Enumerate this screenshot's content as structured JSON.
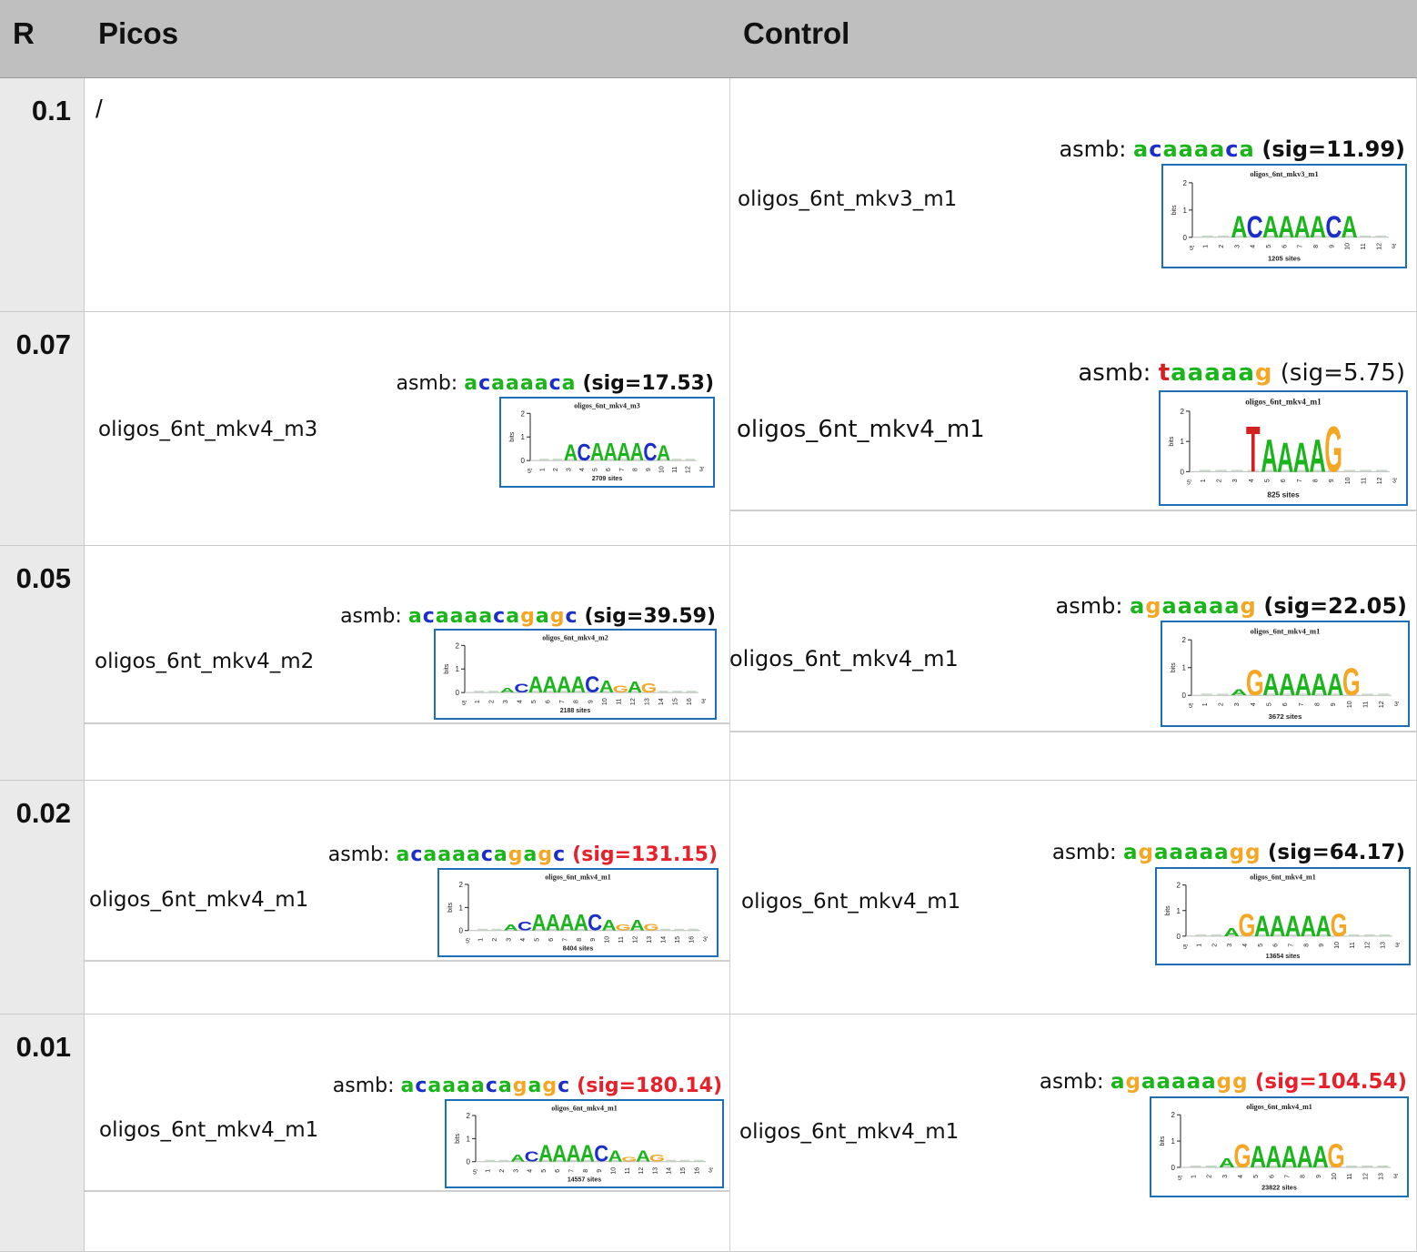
{
  "header": {
    "r": "R",
    "picos": "Picos",
    "control": "Control"
  },
  "axis": {
    "ytick2": "2",
    "ytick1": "1",
    "ytick0": "0",
    "ylabel": "bits",
    "five": "5'",
    "three": "3'"
  },
  "rows": [
    {
      "r": "0.1",
      "picos": {
        "empty": "/"
      },
      "control": {
        "name": "oligos_6nt_mkv3_m1",
        "label": "asmb:",
        "seq": "acaaaaca",
        "sig": "(sig=11.99)",
        "sig_color": "#111111",
        "logo": {
          "title": "oligos_6nt_mkv3_m1",
          "sites": "1205 sites",
          "ticks": [
            "1",
            "2",
            "3",
            "4",
            "5",
            "6",
            "7",
            "8",
            "9",
            "10",
            "11",
            "12"
          ],
          "letters": [
            {
              "pos": 3,
              "ch": "A",
              "h": 0.82,
              "c": "#1ab51a"
            },
            {
              "pos": 4,
              "ch": "C",
              "h": 0.82,
              "c": "#1b2ec9"
            },
            {
              "pos": 5,
              "ch": "A",
              "h": 0.82,
              "c": "#1ab51a"
            },
            {
              "pos": 6,
              "ch": "A",
              "h": 0.82,
              "c": "#1ab51a"
            },
            {
              "pos": 7,
              "ch": "A",
              "h": 0.82,
              "c": "#1ab51a"
            },
            {
              "pos": 8,
              "ch": "A",
              "h": 0.82,
              "c": "#1ab51a"
            },
            {
              "pos": 9,
              "ch": "C",
              "h": 0.82,
              "c": "#1b2ec9"
            },
            {
              "pos": 10,
              "ch": "A",
              "h": 0.82,
              "c": "#1ab51a"
            }
          ]
        }
      }
    },
    {
      "r": "0.07",
      "picos": {
        "name": "oligos_6nt_mkv4_m3",
        "label": "asmb:",
        "seq": "acaaaaca",
        "sig": "(sig=17.53)",
        "sig_color": "#111111",
        "logo": {
          "title": "oligos_6nt_mkv4_m3",
          "sites": "2709 sites",
          "ticks": [
            "1",
            "2",
            "3",
            "4",
            "5",
            "6",
            "7",
            "8",
            "9",
            "10",
            "11",
            "12"
          ],
          "letters": [
            {
              "pos": 3,
              "ch": "A",
              "h": 0.7,
              "c": "#1ab51a"
            },
            {
              "pos": 4,
              "ch": "C",
              "h": 0.72,
              "c": "#1b2ec9"
            },
            {
              "pos": 5,
              "ch": "A",
              "h": 0.76,
              "c": "#1ab51a"
            },
            {
              "pos": 6,
              "ch": "A",
              "h": 0.76,
              "c": "#1ab51a"
            },
            {
              "pos": 7,
              "ch": "A",
              "h": 0.76,
              "c": "#1ab51a"
            },
            {
              "pos": 8,
              "ch": "A",
              "h": 0.76,
              "c": "#1ab51a"
            },
            {
              "pos": 9,
              "ch": "C",
              "h": 0.76,
              "c": "#1b2ec9"
            },
            {
              "pos": 10,
              "ch": "A",
              "h": 0.68,
              "c": "#1ab51a"
            }
          ]
        }
      },
      "control": {
        "name": "oligos_6nt_mkv4_m1",
        "label": "asmb:",
        "seq": "taaaaag",
        "sig": "(sig=5.75)",
        "sig_color": "#111111",
        "logo": {
          "title": "oligos_6nt_mkv4_m1",
          "sites": "825 sites",
          "ticks": [
            "1",
            "2",
            "3",
            "4",
            "5",
            "6",
            "7",
            "8",
            "9",
            "10",
            "11",
            "12"
          ],
          "letters": [
            {
              "pos": 4,
              "ch": "T",
              "h": 1.55,
              "c": "#d42020"
            },
            {
              "pos": 5,
              "ch": "A",
              "h": 1.1,
              "c": "#1ab51a"
            },
            {
              "pos": 6,
              "ch": "A",
              "h": 1.0,
              "c": "#1ab51a"
            },
            {
              "pos": 7,
              "ch": "A",
              "h": 1.0,
              "c": "#1ab51a"
            },
            {
              "pos": 8,
              "ch": "A",
              "h": 1.1,
              "c": "#1ab51a"
            },
            {
              "pos": 9,
              "ch": "G",
              "h": 1.55,
              "c": "#f5a623"
            }
          ]
        }
      }
    },
    {
      "r": "0.05",
      "picos": {
        "name": "oligos_6nt_mkv4_m2",
        "label": "asmb:",
        "seq": "acaaaacagagc",
        "sig": "(sig=39.59)",
        "sig_color": "#111111",
        "logo": {
          "title": "oligos_6nt_mkv4_m2",
          "sites": "2188 sites",
          "ticks": [
            "1",
            "2",
            "3",
            "4",
            "5",
            "6",
            "7",
            "8",
            "9",
            "10",
            "11",
            "12",
            "13",
            "14",
            "15",
            "16"
          ],
          "letters": [
            {
              "pos": 3,
              "ch": "A",
              "h": 0.2,
              "c": "#1ab51a"
            },
            {
              "pos": 4,
              "ch": "C",
              "h": 0.38,
              "c": "#1b2ec9"
            },
            {
              "pos": 5,
              "ch": "A",
              "h": 0.7,
              "c": "#1ab51a"
            },
            {
              "pos": 6,
              "ch": "A",
              "h": 0.7,
              "c": "#1ab51a"
            },
            {
              "pos": 7,
              "ch": "A",
              "h": 0.7,
              "c": "#1ab51a"
            },
            {
              "pos": 8,
              "ch": "A",
              "h": 0.7,
              "c": "#1ab51a"
            },
            {
              "pos": 9,
              "ch": "C",
              "h": 0.7,
              "c": "#1b2ec9"
            },
            {
              "pos": 10,
              "ch": "A",
              "h": 0.52,
              "c": "#1ab51a"
            },
            {
              "pos": 11,
              "ch": "G",
              "h": 0.3,
              "c": "#f5a623"
            },
            {
              "pos": 12,
              "ch": "A",
              "h": 0.5,
              "c": "#1ab51a"
            },
            {
              "pos": 13,
              "ch": "G",
              "h": 0.42,
              "c": "#f5a623"
            }
          ]
        }
      },
      "control": {
        "name": "oligos_6nt_mkv4_m1",
        "label": "asmb:",
        "seq": "agaaaaag",
        "sig": "(sig=22.05)",
        "sig_color": "#111111",
        "logo": {
          "title": "oligos_6nt_mkv4_m1",
          "sites": "3672 sites",
          "ticks": [
            "1",
            "2",
            "3",
            "4",
            "5",
            "6",
            "7",
            "8",
            "9",
            "10",
            "11",
            "12"
          ],
          "letters": [
            {
              "pos": 3,
              "ch": "A",
              "h": 0.22,
              "c": "#1ab51a"
            },
            {
              "pos": 4,
              "ch": "G",
              "h": 0.95,
              "c": "#f5a623"
            },
            {
              "pos": 5,
              "ch": "A",
              "h": 0.8,
              "c": "#1ab51a"
            },
            {
              "pos": 6,
              "ch": "A",
              "h": 0.8,
              "c": "#1ab51a"
            },
            {
              "pos": 7,
              "ch": "A",
              "h": 0.8,
              "c": "#1ab51a"
            },
            {
              "pos": 8,
              "ch": "A",
              "h": 0.8,
              "c": "#1ab51a"
            },
            {
              "pos": 9,
              "ch": "A",
              "h": 0.8,
              "c": "#1ab51a"
            },
            {
              "pos": 10,
              "ch": "G",
              "h": 1.0,
              "c": "#f5a623"
            }
          ]
        }
      }
    },
    {
      "r": "0.02",
      "picos": {
        "name": "oligos_6nt_mkv4_m1",
        "label": "asmb:",
        "seq": "acaaaacagagc",
        "sig": "(sig=131.15)",
        "sig_color": "#e8202a",
        "logo": {
          "title": "oligos_6nt_mkv4_m1",
          "sites": "8404 sites",
          "ticks": [
            "1",
            "2",
            "3",
            "4",
            "5",
            "6",
            "7",
            "8",
            "9",
            "10",
            "11",
            "12",
            "13",
            "14",
            "15",
            "16"
          ],
          "letters": [
            {
              "pos": 3,
              "ch": "A",
              "h": 0.26,
              "c": "#1ab51a"
            },
            {
              "pos": 4,
              "ch": "C",
              "h": 0.4,
              "c": "#1b2ec9"
            },
            {
              "pos": 5,
              "ch": "A",
              "h": 0.72,
              "c": "#1ab51a"
            },
            {
              "pos": 6,
              "ch": "A",
              "h": 0.72,
              "c": "#1ab51a"
            },
            {
              "pos": 7,
              "ch": "A",
              "h": 0.72,
              "c": "#1ab51a"
            },
            {
              "pos": 8,
              "ch": "A",
              "h": 0.72,
              "c": "#1ab51a"
            },
            {
              "pos": 9,
              "ch": "C",
              "h": 0.7,
              "c": "#1b2ec9"
            },
            {
              "pos": 10,
              "ch": "A",
              "h": 0.48,
              "c": "#1ab51a"
            },
            {
              "pos": 11,
              "ch": "G",
              "h": 0.26,
              "c": "#f5a623"
            },
            {
              "pos": 12,
              "ch": "A",
              "h": 0.46,
              "c": "#1ab51a"
            },
            {
              "pos": 13,
              "ch": "G",
              "h": 0.3,
              "c": "#f5a623"
            }
          ]
        }
      },
      "control": {
        "name": "oligos_6nt_mkv4_m1",
        "label": "asmb:",
        "seq": "agaaaaagg",
        "sig": "(sig=64.17)",
        "sig_color": "#111111",
        "logo": {
          "title": "oligos_6nt_mkv4_m1",
          "sites": "13654 sites",
          "ticks": [
            "1",
            "2",
            "3",
            "4",
            "5",
            "6",
            "7",
            "8",
            "9",
            "10",
            "11",
            "12",
            "13"
          ],
          "letters": [
            {
              "pos": 3,
              "ch": "A",
              "h": 0.32,
              "c": "#1ab51a"
            },
            {
              "pos": 4,
              "ch": "G",
              "h": 0.9,
              "c": "#f5a623"
            },
            {
              "pos": 5,
              "ch": "A",
              "h": 0.84,
              "c": "#1ab51a"
            },
            {
              "pos": 6,
              "ch": "A",
              "h": 0.84,
              "c": "#1ab51a"
            },
            {
              "pos": 7,
              "ch": "A",
              "h": 0.84,
              "c": "#1ab51a"
            },
            {
              "pos": 8,
              "ch": "A",
              "h": 0.84,
              "c": "#1ab51a"
            },
            {
              "pos": 9,
              "ch": "A",
              "h": 0.84,
              "c": "#1ab51a"
            },
            {
              "pos": 10,
              "ch": "G",
              "h": 0.9,
              "c": "#f5a623"
            }
          ]
        }
      }
    },
    {
      "r": "0.01",
      "picos": {
        "name": "oligos_6nt_mkv4_m1",
        "label": "asmb:",
        "seq": "acaaaacagagc",
        "sig": "(sig=180.14)",
        "sig_color": "#e8202a",
        "logo": {
          "title": "oligos_6nt_mkv4_m1",
          "sites": "14557 sites",
          "ticks": [
            "1",
            "2",
            "3",
            "4",
            "5",
            "6",
            "7",
            "8",
            "9",
            "10",
            "11",
            "12",
            "13",
            "14",
            "15",
            "16"
          ],
          "letters": [
            {
              "pos": 3,
              "ch": "A",
              "h": 0.3,
              "c": "#1ab51a"
            },
            {
              "pos": 4,
              "ch": "C",
              "h": 0.44,
              "c": "#1b2ec9"
            },
            {
              "pos": 5,
              "ch": "A",
              "h": 0.74,
              "c": "#1ab51a"
            },
            {
              "pos": 6,
              "ch": "A",
              "h": 0.74,
              "c": "#1ab51a"
            },
            {
              "pos": 7,
              "ch": "A",
              "h": 0.74,
              "c": "#1ab51a"
            },
            {
              "pos": 8,
              "ch": "A",
              "h": 0.74,
              "c": "#1ab51a"
            },
            {
              "pos": 9,
              "ch": "C",
              "h": 0.72,
              "c": "#1b2ec9"
            },
            {
              "pos": 10,
              "ch": "A",
              "h": 0.5,
              "c": "#1ab51a"
            },
            {
              "pos": 11,
              "ch": "G",
              "h": 0.22,
              "c": "#f5a623"
            },
            {
              "pos": 12,
              "ch": "A",
              "h": 0.5,
              "c": "#1ab51a"
            },
            {
              "pos": 13,
              "ch": "G",
              "h": 0.3,
              "c": "#f5a623"
            }
          ]
        }
      },
      "control": {
        "name": "oligos_6nt_mkv4_m1",
        "label": "asmb:",
        "seq": "agaaaaagg",
        "sig": "(sig=104.54)",
        "sig_color": "#e8202a",
        "logo": {
          "title": "oligos_6nt_mkv4_m1",
          "sites": "23822 sites",
          "ticks": [
            "1",
            "2",
            "3",
            "4",
            "5",
            "6",
            "7",
            "8",
            "9",
            "10",
            "11",
            "12",
            "13"
          ],
          "letters": [
            {
              "pos": 3,
              "ch": "A",
              "h": 0.36,
              "c": "#1ab51a"
            },
            {
              "pos": 4,
              "ch": "G",
              "h": 0.9,
              "c": "#f5a623"
            },
            {
              "pos": 5,
              "ch": "A",
              "h": 0.86,
              "c": "#1ab51a"
            },
            {
              "pos": 6,
              "ch": "A",
              "h": 0.86,
              "c": "#1ab51a"
            },
            {
              "pos": 7,
              "ch": "A",
              "h": 0.86,
              "c": "#1ab51a"
            },
            {
              "pos": 8,
              "ch": "A",
              "h": 0.86,
              "c": "#1ab51a"
            },
            {
              "pos": 9,
              "ch": "A",
              "h": 0.86,
              "c": "#1ab51a"
            },
            {
              "pos": 10,
              "ch": "G",
              "h": 0.92,
              "c": "#f5a623"
            }
          ]
        }
      }
    }
  ],
  "colors": {
    "a": "#1ab51a",
    "c": "#1b2ec9",
    "g": "#f5a623",
    "t": "#d42020",
    "logo_border": "#1d6fb8",
    "header_bg": "#bfbfbf",
    "rcol_bg": "#eaeaea"
  }
}
